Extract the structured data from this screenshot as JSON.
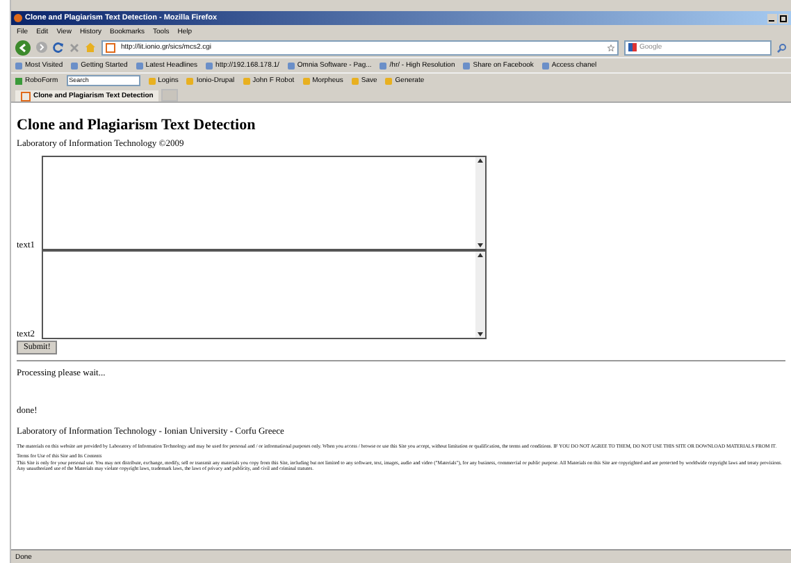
{
  "window": {
    "title": "Clone and Plagiarism Text Detection - Mozilla Firefox"
  },
  "menu": [
    "File",
    "Edit",
    "View",
    "History",
    "Bookmarks",
    "Tools",
    "Help"
  ],
  "navigation": {
    "url": "http://lit.ionio.gr/sics/mcs2.cgi",
    "search_placeholder": "Google"
  },
  "bookmarks": [
    "Most Visited",
    "Getting Started",
    "Latest Headlines",
    "http://192.168.178.1/",
    "Omnia Software - Pag...",
    "/hr/ - High Resolution",
    "Share on Facebook",
    "Access chanel"
  ],
  "roboform": {
    "label": "RoboForm",
    "search_placeholder": "Search",
    "items": [
      "Logins",
      "Ionio-Drupal",
      "John F Robot",
      "Morpheus",
      "Save",
      "Generate"
    ]
  },
  "tabs": [
    {
      "label": "Clone and Plagiarism Text Detection",
      "selected": true
    }
  ],
  "page": {
    "heading": "Clone and Plagiarism Text Detection",
    "subtitle": "Laboratory of Information Technology ©2009",
    "fields": [
      {
        "label": "text1"
      },
      {
        "label": "text2"
      }
    ],
    "submit": "Submit!",
    "processing": "Processing please wait...",
    "done": "done!",
    "footer": "Laboratory of Information Technology - Ionian University - Corfu Greece",
    "legal": [
      "The materials on this website are provided by Laboratory of Information Technology and may be used for personal and / or informational purposes only. When you access / browse or use this Site you accept, without limitation or qualification, the terms and conditions. IF YOU DO NOT AGREE TO THEM, DO NOT USE THIS SITE OR DOWNLOAD MATERIALS FROM IT.",
      "Terms for Use of this Site and Its Contents",
      "This Site is only for your personal use. You may not distribute, exchange, modify, sell or transmit any materials you copy from this Site, including but not limited to any software, text, images, audio and video (\"Materials\"), for any business, commercial or public purpose. All Materials on this Site are copyrighted and are protected by worldwide copyright laws and treaty provisions. Any unauthorized use of the Materials may violate copyright laws, trademark laws, the laws of privacy and publicity, and civil and criminal statutes."
    ]
  },
  "status_bar": {
    "text": "Done"
  }
}
